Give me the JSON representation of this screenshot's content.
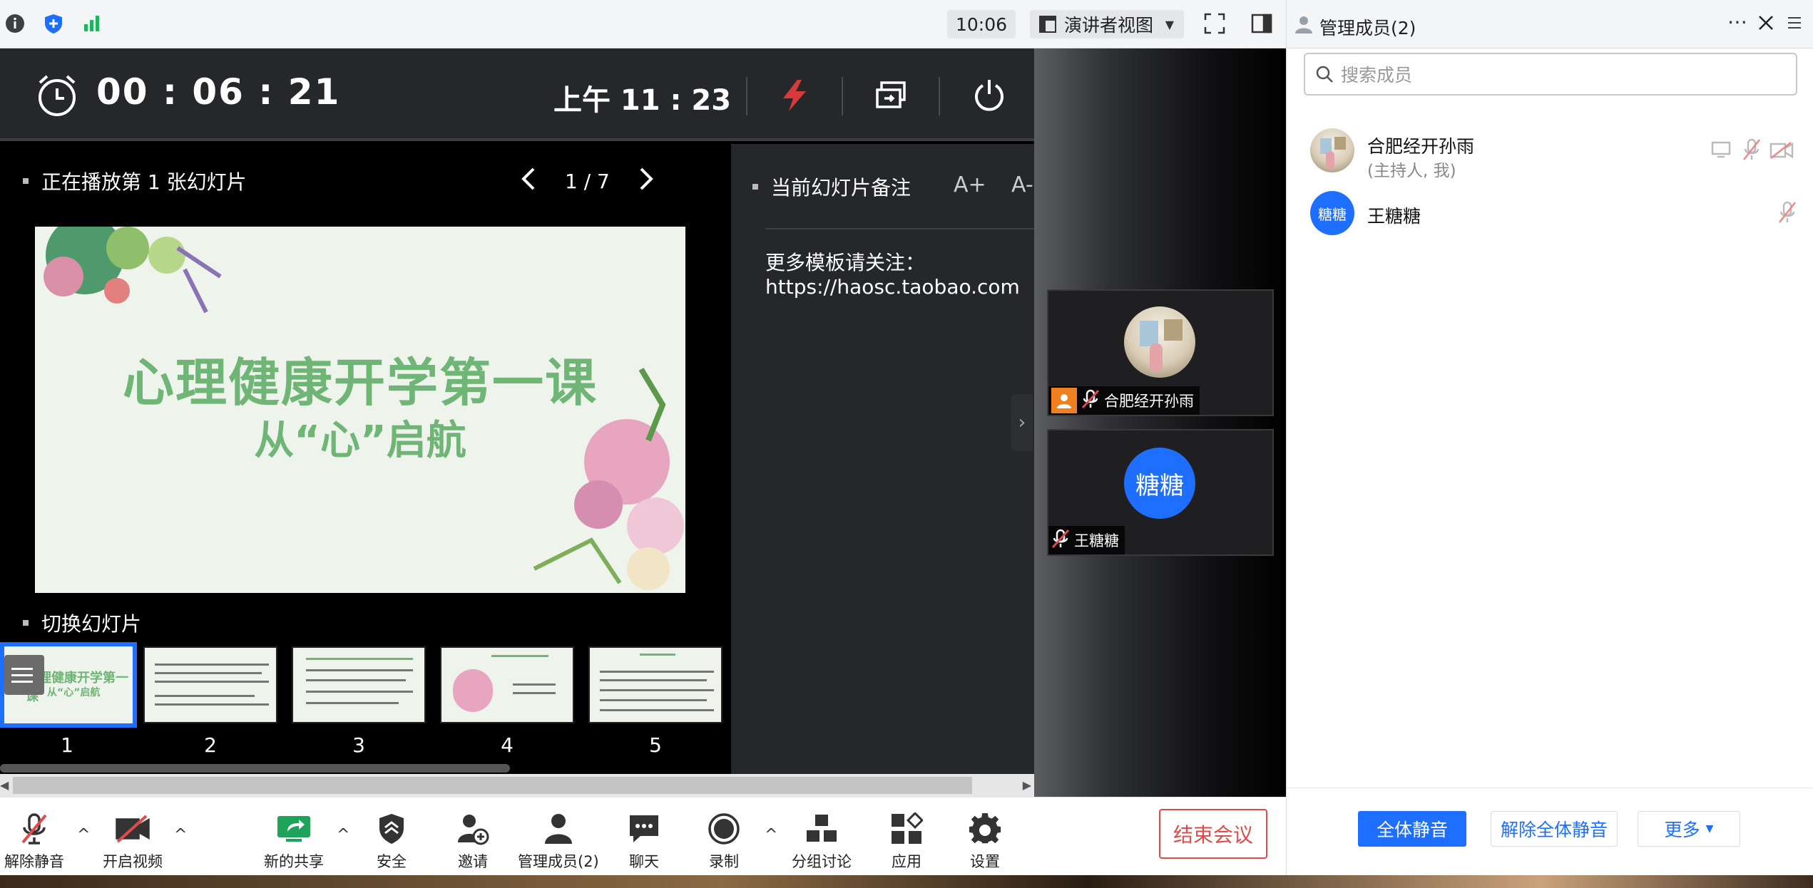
{
  "topbar": {
    "meeting_time": "10:06",
    "view_mode_label": "演讲者视图",
    "icons": [
      "info-icon",
      "shield-plus-icon",
      "signal-bars-icon",
      "fullscreen-icon",
      "sidebar-toggle-icon"
    ]
  },
  "presenter": {
    "timer": "00 : 06 : 21",
    "clock": "上午 11 : 23",
    "now_playing": "正在播放第 1 张幻灯片",
    "page_indicator": "1 / 7",
    "notes_label": "当前幻灯片备注",
    "font_up": "A+",
    "font_down": "A-",
    "notes_line1": "更多模板请关注：",
    "notes_line2": "https://haosc.taobao.com",
    "switch_label": "切换幻灯片",
    "slide_title": "心理健康开学第一课",
    "slide_subtitle": "从“心”启航",
    "thumbnails": [
      {
        "num": "1",
        "active": true
      },
      {
        "num": "2",
        "active": false
      },
      {
        "num": "3",
        "active": false
      },
      {
        "num": "4",
        "active": false
      },
      {
        "num": "5",
        "active": false
      }
    ]
  },
  "video": {
    "tiles": [
      {
        "name": "合肥经开孙雨"
      },
      {
        "name": "王糖糖",
        "avatar_text": "糖糖"
      }
    ]
  },
  "members_panel": {
    "title": "管理成员(2)",
    "search_placeholder": "搜索成员",
    "members": [
      {
        "name": "合肥经开孙雨",
        "role": "(主持人, 我)"
      },
      {
        "name": "王糖糖",
        "avatar_text": "糖糖"
      }
    ],
    "mute_all": "全体静音",
    "unmute_all": "解除全体静音",
    "more": "更多"
  },
  "toolbar": {
    "unmute": "解除静音",
    "start_video": "开启视频",
    "new_share": "新的共享",
    "security": "安全",
    "invite": "邀请",
    "manage_members": "管理成员(2)",
    "chat": "聊天",
    "record": "录制",
    "breakout": "分组讨论",
    "apps": "应用",
    "settings": "设置",
    "end_meeting": "结束会议"
  },
  "colors": {
    "accent": "#1e6fff",
    "danger": "#e04a4a",
    "slide_green": "#6fb575"
  }
}
